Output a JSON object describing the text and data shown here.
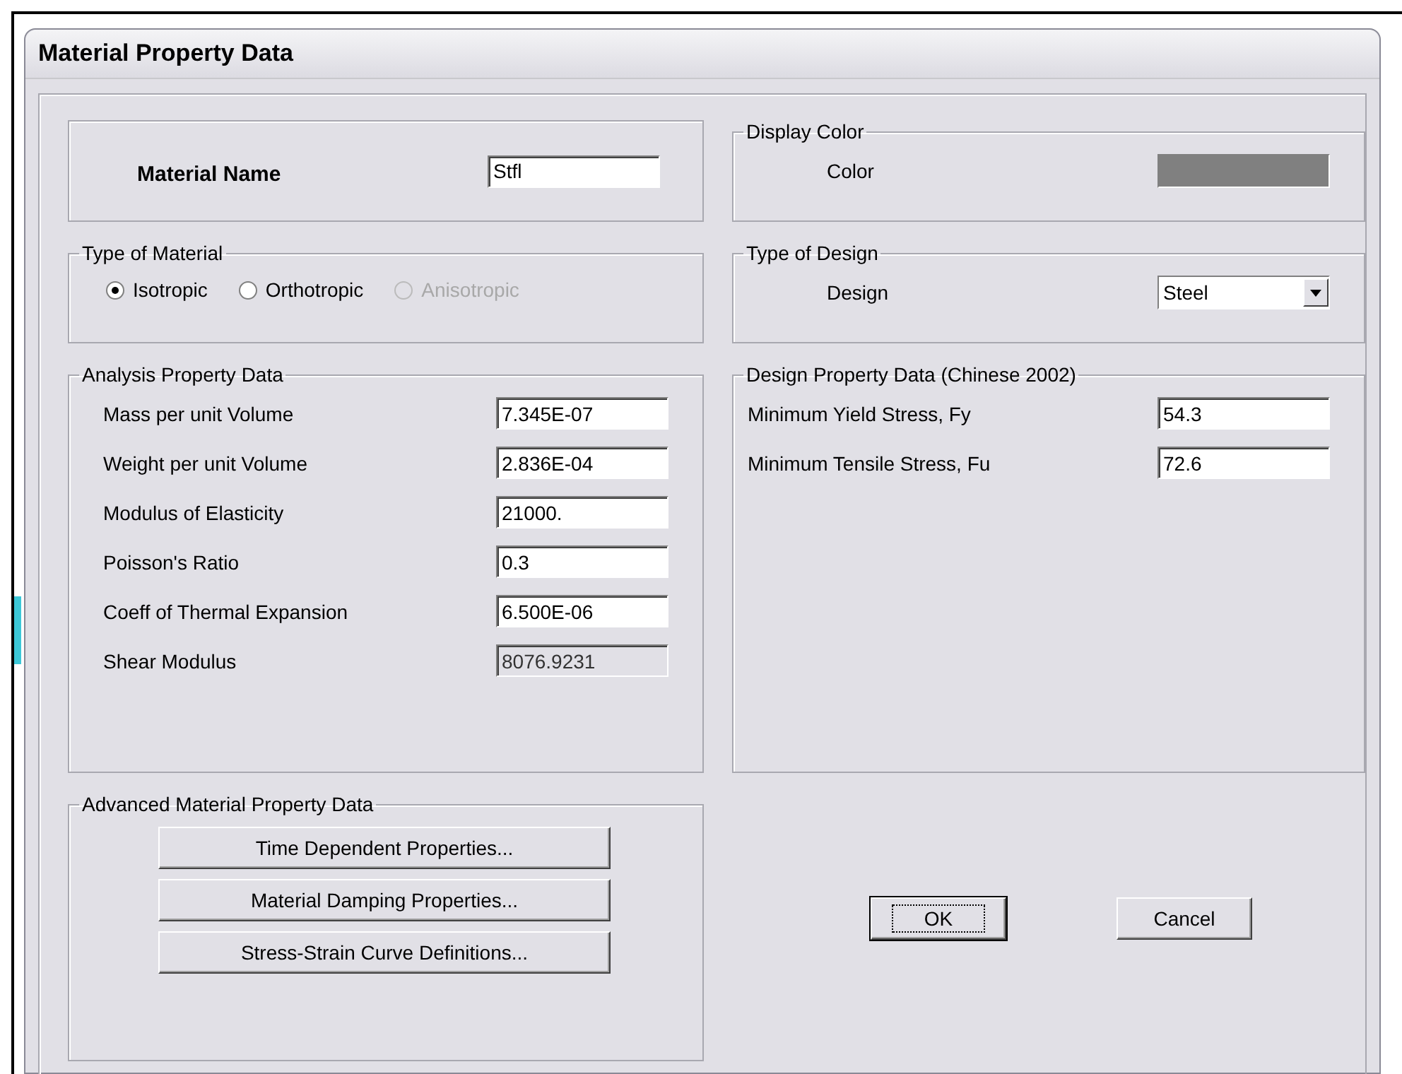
{
  "window": {
    "title": "Material Property Data"
  },
  "material_name": {
    "label": "Material Name",
    "value": "Stfl"
  },
  "display_color": {
    "legend": "Display Color",
    "label": "Color",
    "color": "#808080"
  },
  "type_of_material": {
    "legend": "Type of Material",
    "options": [
      {
        "label": "Isotropic",
        "selected": true,
        "disabled": false
      },
      {
        "label": "Orthotropic",
        "selected": false,
        "disabled": false
      },
      {
        "label": "Anisotropic",
        "selected": false,
        "disabled": true
      }
    ]
  },
  "type_of_design": {
    "legend": "Type of Design",
    "label": "Design",
    "value": "Steel"
  },
  "analysis_property_data": {
    "legend": "Analysis Property Data",
    "fields": [
      {
        "label": "Mass per unit Volume",
        "value": "7.345E-07",
        "disabled": false
      },
      {
        "label": "Weight per unit Volume",
        "value": "2.836E-04",
        "disabled": false
      },
      {
        "label": "Modulus of Elasticity",
        "value": "21000.",
        "disabled": false
      },
      {
        "label": "Poisson's Ratio",
        "value": "0.3",
        "disabled": false
      },
      {
        "label": "Coeff of Thermal Expansion",
        "value": "6.500E-06",
        "disabled": false
      },
      {
        "label": "Shear Modulus",
        "value": "8076.9231",
        "disabled": true
      }
    ]
  },
  "design_property_data": {
    "legend": "Design Property Data (Chinese 2002)",
    "fields": [
      {
        "label": "Minimum Yield Stress, Fy",
        "value": "54.3",
        "disabled": false
      },
      {
        "label": "Minimum Tensile Stress, Fu",
        "value": "72.6",
        "disabled": false
      }
    ]
  },
  "advanced_material_property_data": {
    "legend": "Advanced Material Property Data",
    "buttons": [
      {
        "label": "Time Dependent Properties..."
      },
      {
        "label": "Material Damping Properties..."
      },
      {
        "label": "Stress-Strain Curve Definitions..."
      }
    ]
  },
  "buttons": [
    {
      "label": "OK",
      "focused": true
    },
    {
      "label": "Cancel",
      "focused": false
    }
  ]
}
